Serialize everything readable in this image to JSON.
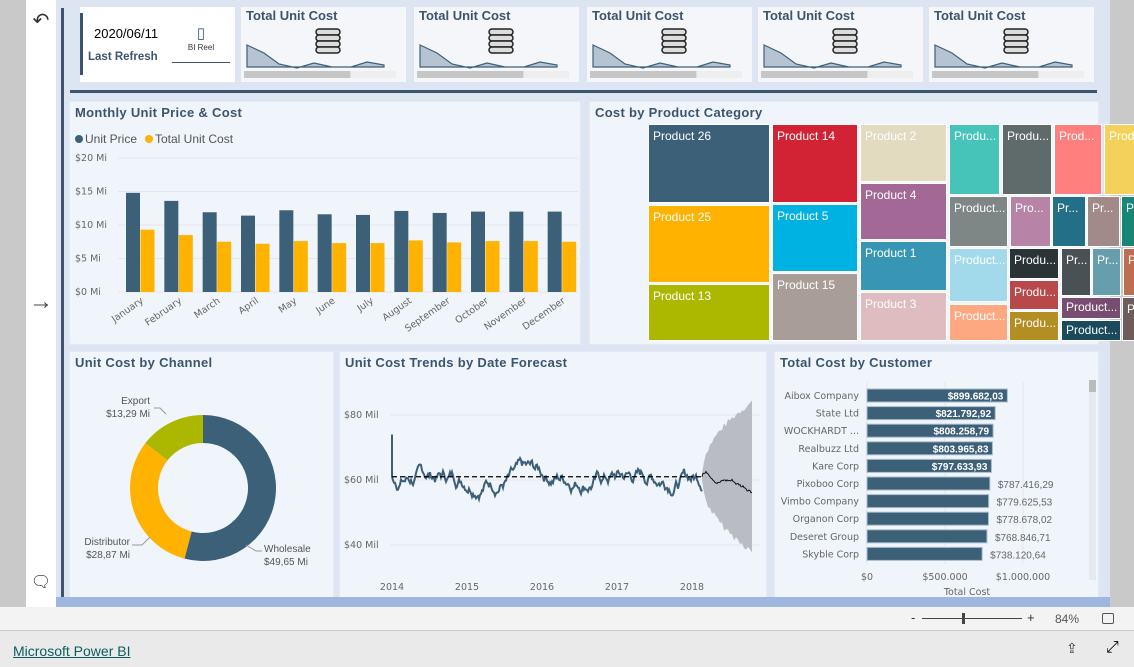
{
  "nav": {
    "undo_icon": "undo-icon",
    "next_icon": "arrow-right-icon",
    "comment_icon": "comment-icon"
  },
  "refresh": {
    "date": "2020/06/11",
    "label": "Last Refresh",
    "logo_text": "BI Reel"
  },
  "kpis": [
    {
      "title": "Total Unit Cost",
      "icon": "coins-icon",
      "progress": 0.7
    },
    {
      "title": "Total Unit Cost",
      "icon": "coins-icon",
      "progress": 0.7
    },
    {
      "title": "Total Unit Cost",
      "icon": "coins-icon",
      "progress": 0.7
    },
    {
      "title": "Total Unit Cost",
      "icon": "coins-icon",
      "progress": 0.7
    },
    {
      "title": "Total Unit Cost",
      "icon": "coins-icon",
      "progress": 0.7
    }
  ],
  "monthly": {
    "title": "Monthly Unit Price & Cost"
  },
  "treemap": {
    "title": "Cost by Product Category"
  },
  "donut": {
    "title": "Unit Cost by Channel"
  },
  "trend": {
    "title": "Unit Cost Trends by Date Forecast"
  },
  "customer": {
    "title": "Total Cost by Customer"
  },
  "chart_data": [
    {
      "type": "bar",
      "title": "Monthly Unit Price & Cost",
      "legend": "top-left",
      "categories": [
        "January",
        "February",
        "March",
        "April",
        "May",
        "June",
        "July",
        "August",
        "September",
        "October",
        "November",
        "December"
      ],
      "series": [
        {
          "name": "Unit Price",
          "color": "#3d6079",
          "values": [
            14.8,
            13.6,
            11.9,
            11.4,
            12.2,
            11.6,
            11.5,
            12.1,
            11.8,
            12.0,
            12.0,
            12.0
          ]
        },
        {
          "name": "Total Unit Cost",
          "color": "#ffb300",
          "values": [
            9.3,
            8.5,
            7.5,
            7.2,
            7.6,
            7.3,
            7.3,
            7.7,
            7.4,
            7.6,
            7.6,
            7.5
          ]
        }
      ],
      "yticks": [
        "$0 Mi",
        "$5 Mi",
        "$10 Mi",
        "$15 Mi",
        "$20 Mi"
      ],
      "ylim": [
        0,
        20
      ],
      "grid": true
    },
    {
      "type": "treemap",
      "title": "Cost by Product Category",
      "items": [
        {
          "label": "Product 26",
          "color": "#3d6079"
        },
        {
          "label": "Product 25",
          "color": "#ffb300"
        },
        {
          "label": "Product 13",
          "color": "#acb700"
        },
        {
          "label": "Product 14",
          "color": "#d12334"
        },
        {
          "label": "Product 5",
          "color": "#00b2e2"
        },
        {
          "label": "Product 15",
          "color": "#a89e97"
        },
        {
          "label": "Product 2",
          "color": "#e2dbc0"
        },
        {
          "label": "Product 4",
          "color": "#a46897"
        },
        {
          "label": "Product 1",
          "color": "#3696b4"
        },
        {
          "label": "Product 3",
          "color": "#debcbf"
        },
        {
          "label": "Produ...",
          "color": "#47c4b9"
        },
        {
          "label": "Produ...",
          "color": "#5f6a6a"
        },
        {
          "label": "Prod...",
          "color": "#fe7f7d"
        },
        {
          "label": "Prod...",
          "color": "#f4d15a"
        },
        {
          "label": "Product...",
          "color": "#7f8686"
        },
        {
          "label": "Pro...",
          "color": "#b784a8"
        },
        {
          "label": "Pr...",
          "color": "#246f88"
        },
        {
          "label": "Pr...",
          "color": "#a28a88"
        },
        {
          "label": "Pr...",
          "color": "#178676"
        },
        {
          "label": "Product...",
          "color": "#a3daeb"
        },
        {
          "label": "Product...",
          "color": "#fea882"
        },
        {
          "label": "Produ...",
          "color": "#2a3336"
        },
        {
          "label": "Produ...",
          "color": "#b8494b"
        },
        {
          "label": "Produ...",
          "color": "#b38f23"
        },
        {
          "label": "Pr...",
          "color": "#4a5154"
        },
        {
          "label": "Pr...",
          "color": "#679eae"
        },
        {
          "label": "Pr...",
          "color": "#bc6e50"
        },
        {
          "label": "Product...",
          "color": "#794d72"
        },
        {
          "label": "Product...",
          "color": "#1a4a5c"
        },
        {
          "label": "Pr...",
          "color": "#6c5c5a"
        }
      ]
    },
    {
      "type": "pie",
      "title": "Unit Cost by Channel",
      "donut": true,
      "slices": [
        {
          "name": "Wholesale",
          "value": 49.65,
          "label": "$49,65 Mi",
          "color": "#3d6079"
        },
        {
          "name": "Distributor",
          "value": 28.87,
          "label": "$28,87 Mi",
          "color": "#ffb300"
        },
        {
          "name": "Export",
          "value": 13.29,
          "label": "$13,29 Mi",
          "color": "#acb700"
        }
      ]
    },
    {
      "type": "line",
      "title": "Unit Cost Trends by Date Forecast",
      "xticks": [
        "2014",
        "2015",
        "2016",
        "2017",
        "2018"
      ],
      "yticks": [
        "$40 Mil",
        "$60 Mil",
        "$80 Mil"
      ],
      "ylim": [
        35,
        90
      ],
      "mean": 61,
      "forecast_range": [
        "2018-03",
        "2018-11"
      ],
      "forecast_band": [
        [
          61,
          61
        ],
        [
          40,
          83
        ]
      ]
    },
    {
      "type": "bar",
      "orientation": "horizontal",
      "title": "Total Cost by Customer",
      "xlabel": "Total Cost",
      "xticks": [
        "$0",
        "$500.000",
        "$1.000.000"
      ],
      "xlim": [
        0,
        1000000
      ],
      "categories": [
        "Aibox Company",
        "State Ltd",
        "WOCKHARDT ...",
        "Realbuzz Ltd",
        "Kare Corp",
        "Pixoboo Corp",
        "Vimbo Company",
        "Organon Corp",
        "Deseret Group",
        "Skyble Corp"
      ],
      "values": [
        899682.03,
        821792.92,
        808258.79,
        803965.83,
        797633.93,
        787416.29,
        779625.53,
        778678.02,
        768846.71,
        738120.64
      ],
      "labels": [
        "$899.682,03",
        "$821.792,92",
        "$808.258,79",
        "$803.965,83",
        "$797.633,93",
        "$787.416,29",
        "$779.625,53",
        "$778.678,02",
        "$768.846,71",
        "$738.120,64"
      ],
      "color": "#3d6079"
    }
  ],
  "status": {
    "zoom_minus": "-",
    "zoom_plus": "+",
    "zoom": "84%",
    "zoom_level": 0.84,
    "fit_icon": "fit-page-icon"
  },
  "footer": {
    "link": "Microsoft Power BI",
    "share_icon": "share-icon",
    "expand_icon": "expand-icon"
  }
}
